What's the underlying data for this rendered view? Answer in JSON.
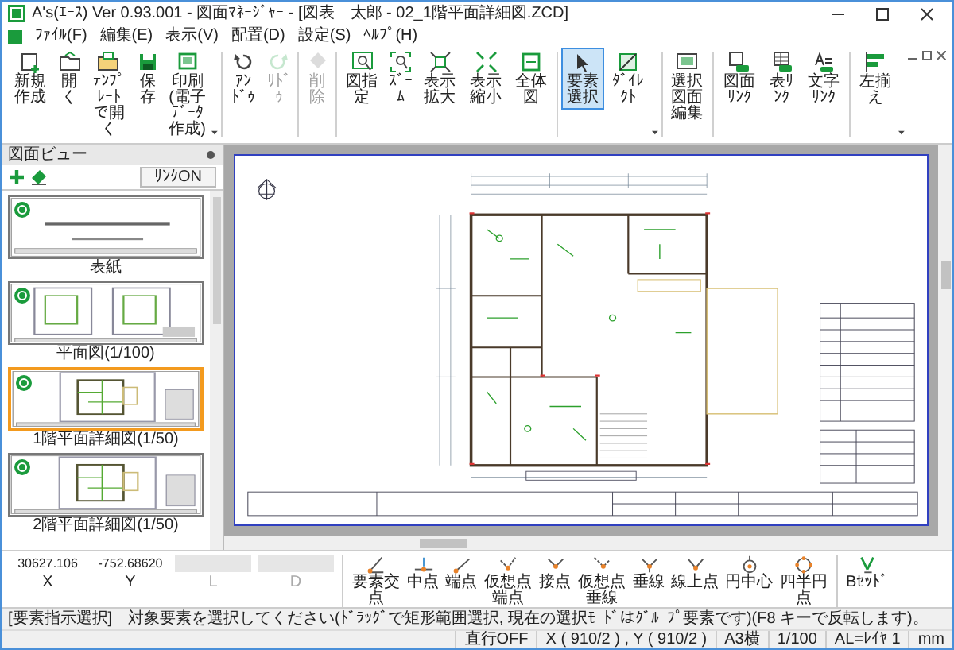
{
  "window": {
    "title": "A's(ｴｰｽ) Ver 0.93.001 - 図面ﾏﾈｰｼﾞｬｰ - [図表　太郎 - 02_1階平面詳細図.ZCD]"
  },
  "menu": [
    "ﾌｧｲﾙ(F)",
    "編集(E)",
    "表示(V)",
    "配置(D)",
    "設定(S)",
    "ﾍﾙﾌﾟ(H)"
  ],
  "toolbar": {
    "groups": [
      [
        {
          "label": "新規作成",
          "kind": "new",
          "disabled": false,
          "selected": false,
          "dropdown": false
        },
        {
          "label": "開く",
          "kind": "open",
          "disabled": false,
          "selected": false,
          "dropdown": false
        },
        {
          "label": "ﾃﾝﾌﾟﾚｰﾄで開く",
          "kind": "template",
          "disabled": false,
          "selected": false,
          "dropdown": false
        },
        {
          "label": "保存",
          "kind": "save",
          "disabled": false,
          "selected": false,
          "dropdown": false
        },
        {
          "label": "印刷(電子ﾃﾞｰﾀ作成)",
          "kind": "print",
          "disabled": false,
          "selected": false,
          "dropdown": true
        }
      ],
      [
        {
          "label": "ｱﾝﾄﾞｩ",
          "kind": "undo",
          "disabled": false,
          "selected": false,
          "dropdown": false
        },
        {
          "label": "ﾘﾄﾞｩ",
          "kind": "redo",
          "disabled": true,
          "selected": false,
          "dropdown": false
        }
      ],
      [
        {
          "label": "削除",
          "kind": "delete",
          "disabled": true,
          "selected": false,
          "dropdown": false
        }
      ],
      [
        {
          "label": "図指定",
          "kind": "window",
          "disabled": false,
          "selected": false,
          "dropdown": false
        },
        {
          "label": "ｽﾞｰﾑ",
          "kind": "zoom",
          "disabled": false,
          "selected": false,
          "dropdown": false
        },
        {
          "label": "表示拡大",
          "kind": "zoom-in",
          "disabled": false,
          "selected": false,
          "dropdown": false
        },
        {
          "label": "表示縮小",
          "kind": "zoom-out",
          "disabled": false,
          "selected": false,
          "dropdown": false
        },
        {
          "label": "全体図",
          "kind": "fit",
          "disabled": false,
          "selected": false,
          "dropdown": false
        }
      ],
      [
        {
          "label": "要素選択",
          "kind": "select",
          "disabled": false,
          "selected": true,
          "dropdown": false
        },
        {
          "label": "ﾀﾞｲﾚｸﾄ",
          "kind": "direct",
          "disabled": false,
          "selected": false,
          "dropdown": true
        }
      ],
      [
        {
          "label": "選択図面編集",
          "kind": "edit",
          "disabled": false,
          "selected": false,
          "dropdown": false
        }
      ],
      [
        {
          "label": "図面ﾘﾝｸ",
          "kind": "link-sheet",
          "disabled": false,
          "selected": false,
          "dropdown": false
        },
        {
          "label": "表ﾘﾝｸ",
          "kind": "link-table",
          "disabled": false,
          "selected": false,
          "dropdown": false
        },
        {
          "label": "文字ﾘﾝｸ",
          "kind": "link-text",
          "disabled": false,
          "selected": false,
          "dropdown": false
        }
      ],
      [
        {
          "label": "左揃え",
          "kind": "align",
          "disabled": false,
          "selected": false,
          "dropdown": true
        }
      ]
    ]
  },
  "sheet_panel": {
    "title": "図面ビュー",
    "link_button": "ﾘﾝｸON",
    "sheets": [
      {
        "label": "表紙",
        "kind": "cover",
        "selected": false
      },
      {
        "label": "平面図(1/100)",
        "kind": "plans",
        "selected": false
      },
      {
        "label": "1階平面詳細図(1/50)",
        "kind": "detail",
        "selected": true
      },
      {
        "label": "2階平面詳細図(1/50)",
        "kind": "detail",
        "selected": false
      }
    ]
  },
  "coordinates": [
    {
      "label": "X",
      "value": "30627.106",
      "disabled": false
    },
    {
      "label": "Y",
      "value": "-752.68620",
      "disabled": false
    },
    {
      "label": "L",
      "disabled": true
    },
    {
      "label": "D",
      "disabled": true
    }
  ],
  "snaps": [
    {
      "label": "要素交点",
      "kind": "intersection"
    },
    {
      "label": "中点",
      "kind": "midpoint"
    },
    {
      "label": "端点",
      "kind": "endpoint"
    },
    {
      "label": "仮想点端点",
      "kind": "virtual-end"
    },
    {
      "label": "接点",
      "kind": "tangent"
    },
    {
      "label": "仮想点垂線",
      "kind": "virtual-perp"
    },
    {
      "label": "垂線",
      "kind": "perpendicular"
    },
    {
      "label": "線上点",
      "kind": "on-line"
    },
    {
      "label": "円中心",
      "kind": "center"
    },
    {
      "label": "四半円点",
      "kind": "quadrant"
    },
    {
      "label": "Bｾｯﾄﾞ",
      "kind": "offset"
    }
  ],
  "status_bar": {
    "message": "[要素指示選択]　対象要素を選択してください(ﾄﾞﾗｯｸﾞで矩形範囲選択, 現在の選択ﾓｰﾄﾞはｸﾞﾙｰﾌﾟ要素です)(F8 キーで反転します)。",
    "cells": [
      "直行OFF",
      "X ( 910/2 ) , Y ( 910/2 )",
      "A3横",
      "1/100",
      "AL=ﾚｲﾔ 1",
      "mm"
    ]
  }
}
